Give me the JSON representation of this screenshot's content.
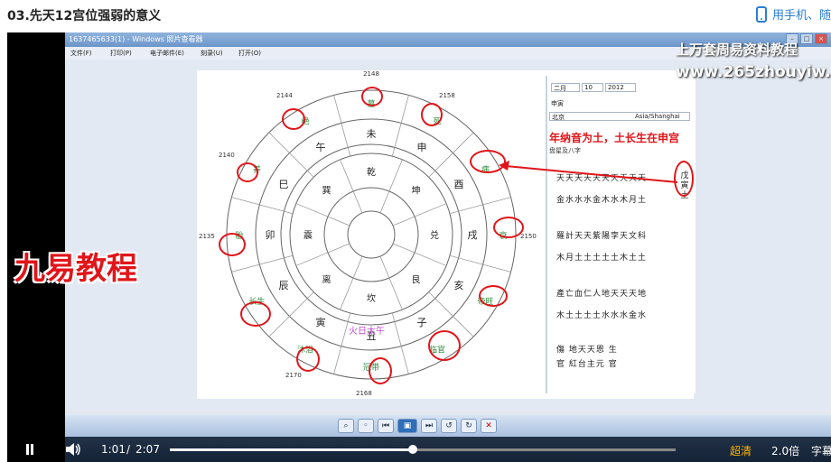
{
  "page": {
    "course_title": "03.先天12宫位强弱的意义",
    "phone_link": "用手机、随"
  },
  "window": {
    "title": "1637465633(1) - Windows 照片查看器",
    "menu": [
      "文件(F)",
      "打印(P)",
      "电子邮件(E)",
      "刻录(U)",
      "打开(O)"
    ]
  },
  "watermark": {
    "line1": "上万套周易资料教程",
    "line2": "www.265zhouyiw.com"
  },
  "overlay_logo": "九易教程",
  "annotation": "年纳音为土，土长生在申宫",
  "chart": {
    "outer_numbers": [
      "2148",
      "2144",
      "2158",
      "2140",
      "2135",
      "2150",
      "2170",
      "2168"
    ],
    "palace_labels": [
      "卯",
      "巳",
      "午",
      "未",
      "申",
      "酉",
      "戌",
      "亥",
      "子",
      "丑",
      "寅",
      "辰"
    ],
    "inner_labels": [
      "乾",
      "坤",
      "兑",
      "艮",
      "坎",
      "离",
      "震",
      "巽"
    ],
    "center_text": "火日太午",
    "circled_stages": [
      "胎",
      "养",
      "绝",
      "墓",
      "死",
      "病",
      "衰",
      "帝旺",
      "临官",
      "冠带",
      "沐浴",
      "长生"
    ]
  },
  "panel": {
    "month_label": "二月",
    "day_value": "10",
    "year_value": "2012",
    "place_label": "申寅",
    "city": "北京",
    "timezone": "Asia/Shanghai",
    "section_label": "盘星及八字",
    "right_side": "戊寅土",
    "grid_rows": [
      "天天天天天天天天天天",
      "金水水水金木水木月土",
      "羅計天天紫陽孛天文科",
      "木月土土土土土木土土",
      "產亡血仁人地天天天地",
      "木土土土土水水水金水",
      "傷 地天天恩 生",
      "官 紅台主元 官"
    ]
  },
  "player": {
    "current_time": "1:01",
    "separator": "/",
    "duration": "2:07",
    "progress": 0.48,
    "quality": "超清",
    "speed": "2.0倍",
    "subtitle": "字幕"
  }
}
